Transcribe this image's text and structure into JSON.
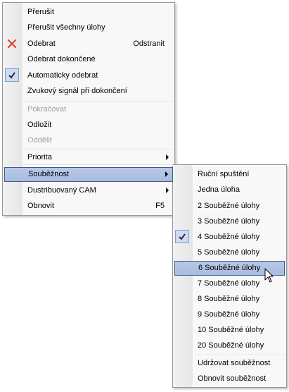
{
  "menu": {
    "items": [
      {
        "label": "Přerušit"
      },
      {
        "label": "Přerušit všechny úlohy"
      },
      {
        "label": "Odebrat",
        "shortcut": "Odstranit",
        "icon": "delete-x-icon"
      },
      {
        "label": "Odebrat dokončené"
      },
      {
        "label": "Automaticky odebrat",
        "checked": true
      },
      {
        "label": "Zvukový signál při dokončení"
      },
      {
        "label": "Pokračovat",
        "disabled": true
      },
      {
        "label": "Odložit"
      },
      {
        "label": "Oddělit",
        "disabled": true
      },
      {
        "label": "Priorita",
        "submenu": true
      },
      {
        "label": "Souběžnost",
        "submenu": true,
        "highlighted": true
      },
      {
        "label": "Dustribuovaný CAM",
        "submenu": true
      },
      {
        "label": "Obnovit",
        "shortcut": "F5"
      }
    ]
  },
  "submenu": {
    "items": [
      {
        "label": "Ruční spuštění"
      },
      {
        "label": "Jedna úloha"
      },
      {
        "label": "2 Souběžné úlohy"
      },
      {
        "label": "3 Souběžné úlohy"
      },
      {
        "label": "4 Souběžné úlohy",
        "checked": true
      },
      {
        "label": "5 Souběžné úlohy"
      },
      {
        "label": "6 Souběžné úlohy",
        "highlighted": true
      },
      {
        "label": "7 Souběžné úlohy"
      },
      {
        "label": "8 Souběžné úlohy"
      },
      {
        "label": "9 Souběžné úlohy"
      },
      {
        "label": "10 Souběžné úlohy"
      },
      {
        "label": "20 Souběžné úlohy"
      },
      {
        "label": "Udržovat souběžnost"
      },
      {
        "label": "Obnovit souběžnost"
      }
    ]
  },
  "colors": {
    "highlight": "#b8c8e8",
    "highlight_border": "#3f5a8c",
    "delete_icon": "#d9472b",
    "check_background": "#cfdcf0"
  }
}
